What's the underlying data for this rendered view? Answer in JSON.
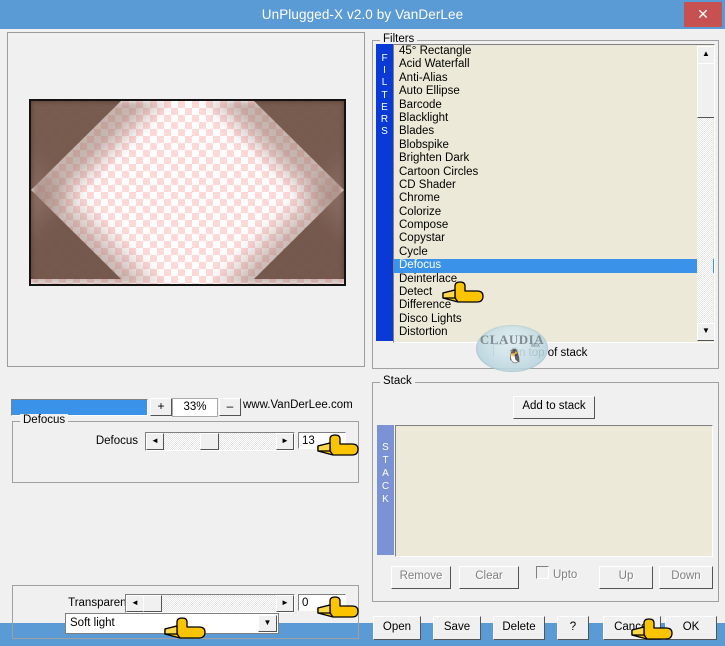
{
  "window": {
    "title": "UnPlugged-X v2.0 by VanDerLee",
    "close_label": "✕"
  },
  "preview": {
    "zoom_value": "33%",
    "zoom_in_label": "+",
    "zoom_out_label": "–",
    "website": "www.VanDerLee.com",
    "progress_percent": 100
  },
  "filters": {
    "group_label": "Filters",
    "sidebar_label": "FILTERS",
    "selected": "Defocus",
    "items": [
      "45° Rectangle",
      "Acid Waterfall",
      "Anti-Alias",
      "Auto Ellipse",
      "Barcode",
      "Blacklight",
      "Blades",
      "Blobspike",
      "Brighten Dark",
      "Cartoon Circles",
      "CD Shader",
      "Chrome",
      "Colorize",
      "Compose",
      "Copystar",
      "Cycle",
      "Defocus",
      "Deinterlace",
      "Detect",
      "Difference",
      "Disco Lights",
      "Distortion"
    ],
    "scroll_up_label": "▲",
    "scroll_down_label": "▼",
    "on_top_of_stack_label": "On top of stack",
    "on_top_of_stack_checked": false
  },
  "watermark": {
    "text": "CLAUDIA",
    "subtext": "MiX"
  },
  "defocus_panel": {
    "group_label": "Defocus",
    "slider_label": "Defocus",
    "value": "13",
    "left_arrow": "◄",
    "right_arrow": "►"
  },
  "transparency_panel": {
    "slider_label": "Transparency",
    "value": "0",
    "left_arrow": "◄",
    "right_arrow": "►",
    "blend_mode": "Soft light",
    "combo_arrow": "▼"
  },
  "stack": {
    "group_label": "Stack",
    "sidebar_label": "STACK",
    "add_label": "Add to stack",
    "items": [],
    "remove_label": "Remove",
    "clear_label": "Clear",
    "upto_label": "Upto",
    "upto_checked": false,
    "up_label": "Up",
    "down_label": "Down"
  },
  "bottom_buttons": {
    "open": "Open",
    "save": "Save",
    "delete": "Delete",
    "help": "?",
    "cancel": "Cancel",
    "ok": "OK"
  },
  "colors": {
    "titlebar": "#5b9bd5",
    "close": "#c75050",
    "selection": "#3a93e8",
    "filters_sidebar": "#0a3ad6",
    "stack_sidebar": "#7b93d4",
    "listbox_bg": "#ece9d8",
    "dialog_bg": "#f0f0f0"
  }
}
